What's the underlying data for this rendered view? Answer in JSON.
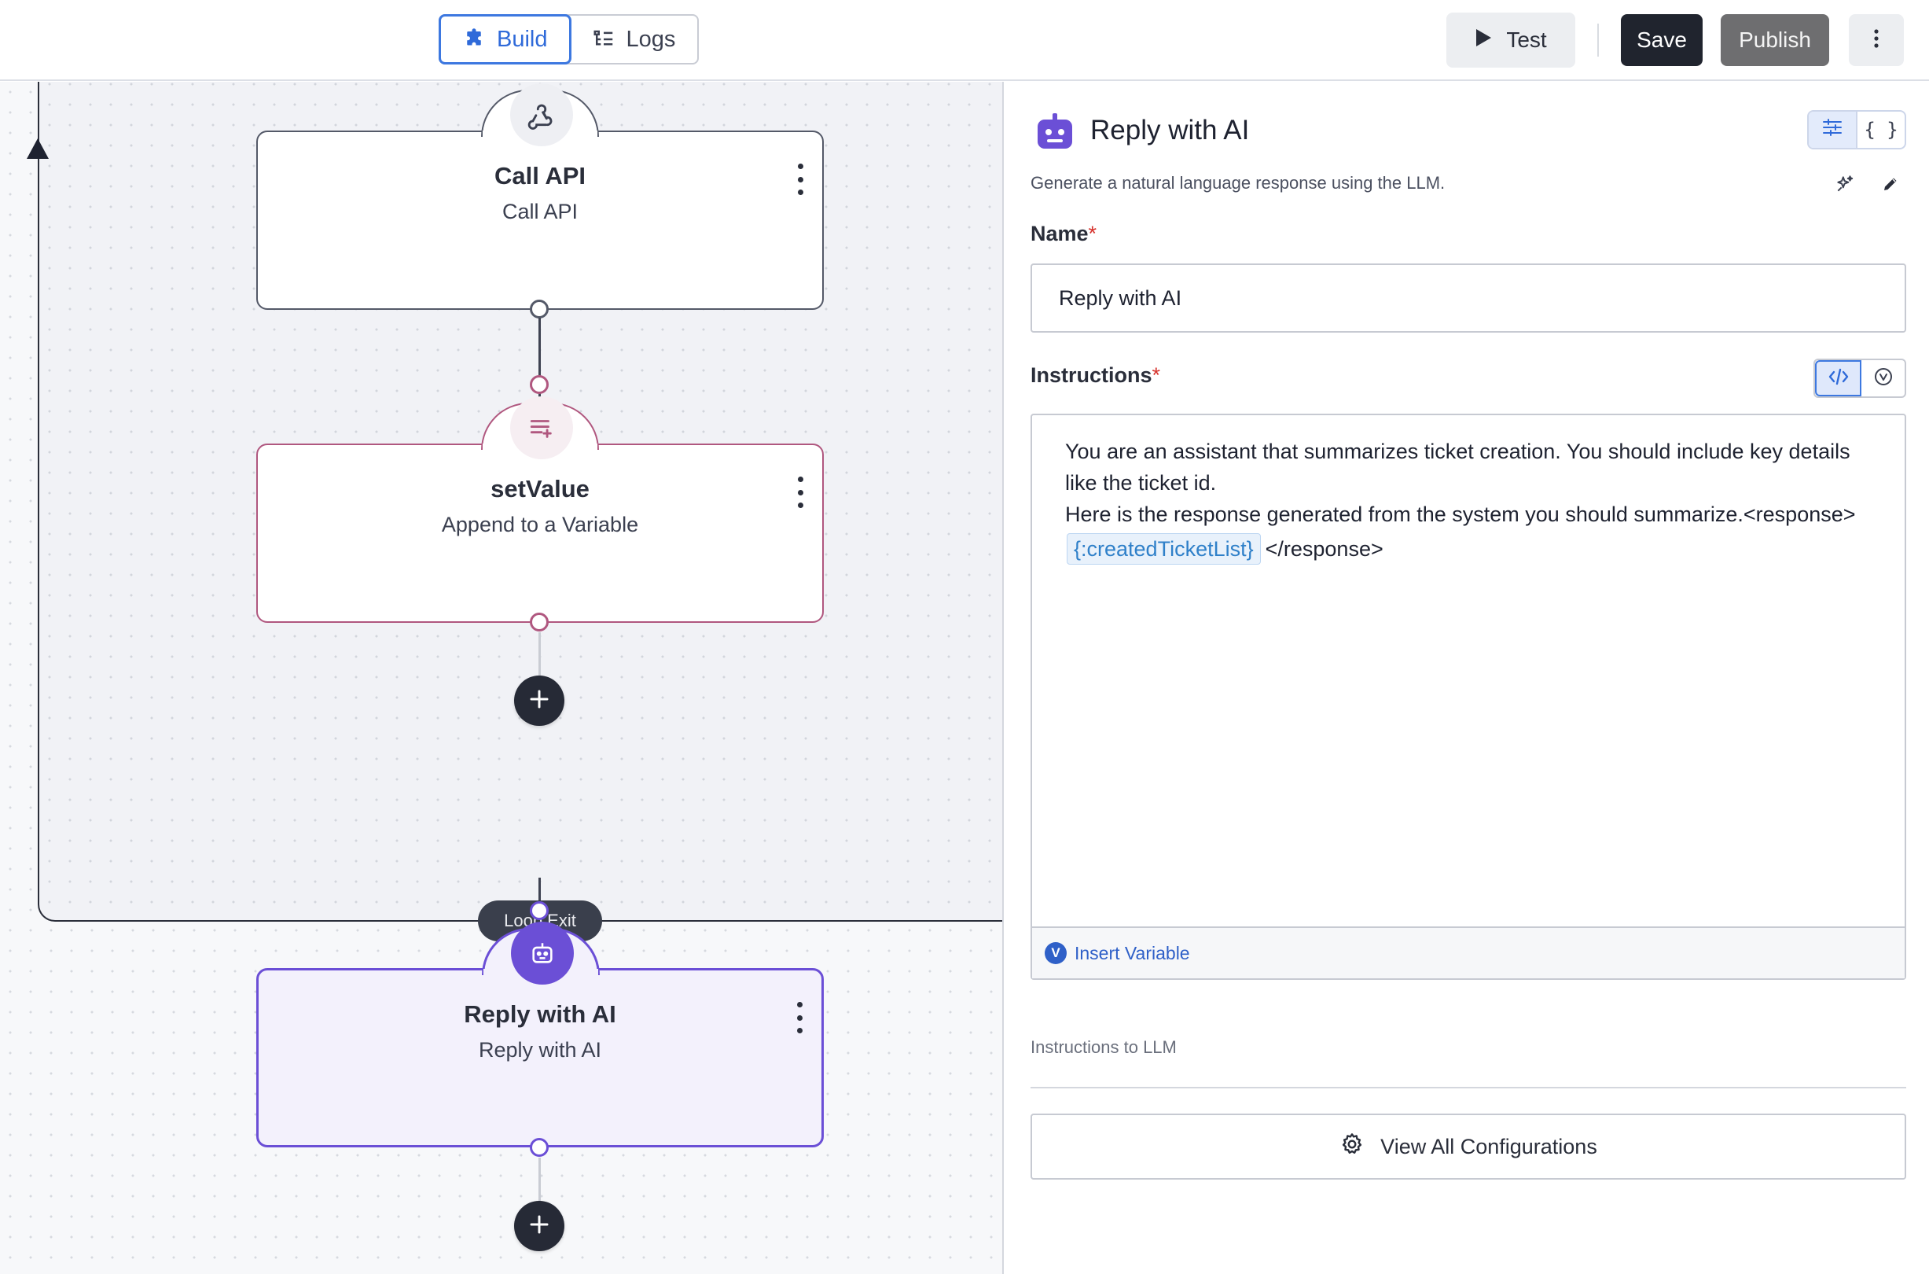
{
  "toolbar": {
    "tabs": [
      {
        "label": "Build",
        "icon": "puzzle-icon",
        "active": true
      },
      {
        "label": "Logs",
        "icon": "list-tree-icon",
        "active": false
      }
    ],
    "test_label": "Test",
    "save_label": "Save",
    "publish_label": "Publish",
    "more_icon": "more-vertical-icon"
  },
  "canvas": {
    "loop_label": "Loop Exit",
    "nodes": [
      {
        "title": "Call API",
        "subtitle": "Call API",
        "icon": "webhook-icon"
      },
      {
        "title": "setValue",
        "subtitle": "Append to a Variable",
        "icon": "list-plus-icon"
      },
      {
        "title": "Reply with AI",
        "subtitle": "Reply with AI",
        "icon": "robot-icon",
        "selected": true
      }
    ]
  },
  "panel": {
    "title": "Reply with AI",
    "description": "Generate a natural language response using the LLM.",
    "view_toggle": [
      "form-view",
      "{ }"
    ],
    "name_label": "Name",
    "name_value": "Reply with AI",
    "instructions_label": "Instructions",
    "instructions": {
      "line1": "You are an assistant that summarizes ticket creation. You should include key details like the ticket id.",
      "line2": "Here is the response generated from the system you should summarize.<response>",
      "variable": "{:createdTicketList}",
      "line3": "</response>"
    },
    "insert_variable_label": "Insert Variable",
    "insert_variable_badge": "V",
    "hint": "Instructions to LLM",
    "view_all_label": "View All Configurations"
  },
  "colors": {
    "accent_blue": "#3d78e0",
    "ai_purple": "#6b4fd6",
    "setvalue_pink": "#b0577f",
    "dark": "#20242e",
    "required_red": "#d6322c"
  }
}
